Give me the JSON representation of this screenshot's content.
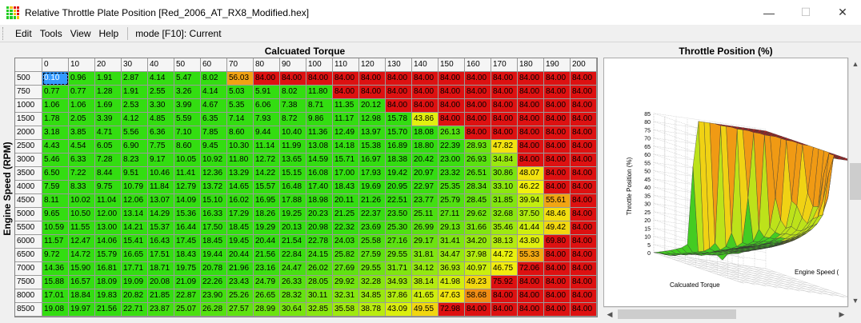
{
  "window": {
    "title": "Relative Throttle Plate Position [Red_2006_AT_RX8_Modified.hex]",
    "minimize": "—",
    "maximize": "☐",
    "close": "✕"
  },
  "menu": {
    "items": [
      "Edit",
      "Tools",
      "View",
      "Help"
    ],
    "mode": "mode [F10]: Current"
  },
  "table": {
    "title": "Calcuated Torque",
    "row_axis_title": "Engine Speed (RPM)",
    "columns": [
      "0",
      "10",
      "20",
      "30",
      "40",
      "50",
      "60",
      "70",
      "80",
      "90",
      "100",
      "110",
      "120",
      "130",
      "140",
      "150",
      "160",
      "170",
      "180",
      "190",
      "200"
    ],
    "rows": [
      {
        "rpm": "500",
        "values": [
          "0.10",
          "0.96",
          "1.91",
          "2.87",
          "4.14",
          "5.47",
          "8.02",
          "56.03",
          "84.00",
          "84.00",
          "84.00",
          "84.00",
          "84.00",
          "84.00",
          "84.00",
          "84.00",
          "84.00",
          "84.00",
          "84.00",
          "84.00",
          "84.00"
        ]
      },
      {
        "rpm": "750",
        "values": [
          "0.77",
          "0.77",
          "1.28",
          "1.91",
          "2.55",
          "3.26",
          "4.14",
          "5.03",
          "5.91",
          "8.02",
          "11.80",
          "84.00",
          "84.00",
          "84.00",
          "84.00",
          "84.00",
          "84.00",
          "84.00",
          "84.00",
          "84.00",
          "84.00"
        ]
      },
      {
        "rpm": "1000",
        "values": [
          "1.06",
          "1.06",
          "1.69",
          "2.53",
          "3.30",
          "3.99",
          "4.67",
          "5.35",
          "6.06",
          "7.38",
          "8.71",
          "11.35",
          "20.12",
          "84.00",
          "84.00",
          "84.00",
          "84.00",
          "84.00",
          "84.00",
          "84.00",
          "84.00"
        ]
      },
      {
        "rpm": "1500",
        "values": [
          "1.78",
          "2.05",
          "3.39",
          "4.12",
          "4.85",
          "5.59",
          "6.35",
          "7.14",
          "7.93",
          "8.72",
          "9.86",
          "11.17",
          "12.98",
          "15.78",
          "43.86",
          "84.00",
          "84.00",
          "84.00",
          "84.00",
          "84.00",
          "84.00"
        ]
      },
      {
        "rpm": "2000",
        "values": [
          "3.18",
          "3.85",
          "4.71",
          "5.56",
          "6.36",
          "7.10",
          "7.85",
          "8.60",
          "9.44",
          "10.40",
          "11.36",
          "12.49",
          "13.97",
          "15.70",
          "18.08",
          "26.13",
          "84.00",
          "84.00",
          "84.00",
          "84.00",
          "84.00"
        ]
      },
      {
        "rpm": "2500",
        "values": [
          "4.43",
          "4.54",
          "6.05",
          "6.90",
          "7.75",
          "8.60",
          "9.45",
          "10.30",
          "11.14",
          "11.99",
          "13.08",
          "14.18",
          "15.38",
          "16.89",
          "18.80",
          "22.39",
          "28.93",
          "47.82",
          "84.00",
          "84.00",
          "84.00"
        ]
      },
      {
        "rpm": "3000",
        "values": [
          "5.46",
          "6.33",
          "7.28",
          "8.23",
          "9.17",
          "10.05",
          "10.92",
          "11.80",
          "12.72",
          "13.65",
          "14.59",
          "15.71",
          "16.97",
          "18.38",
          "20.42",
          "23.00",
          "26.93",
          "34.84",
          "84.00",
          "84.00",
          "84.00"
        ]
      },
      {
        "rpm": "3500",
        "values": [
          "6.50",
          "7.22",
          "8.44",
          "9.51",
          "10.46",
          "11.41",
          "12.36",
          "13.29",
          "14.22",
          "15.15",
          "16.08",
          "17.00",
          "17.93",
          "19.42",
          "20.97",
          "23.32",
          "26.51",
          "30.86",
          "48.07",
          "84.00",
          "84.00"
        ]
      },
      {
        "rpm": "4000",
        "values": [
          "7.59",
          "8.33",
          "9.75",
          "10.79",
          "11.84",
          "12.79",
          "13.72",
          "14.65",
          "15.57",
          "16.48",
          "17.40",
          "18.43",
          "19.69",
          "20.95",
          "22.97",
          "25.35",
          "28.34",
          "33.10",
          "46.22",
          "84.00",
          "84.00"
        ]
      },
      {
        "rpm": "4500",
        "values": [
          "8.11",
          "10.02",
          "11.04",
          "12.06",
          "13.07",
          "14.09",
          "15.10",
          "16.02",
          "16.95",
          "17.88",
          "18.98",
          "20.11",
          "21.26",
          "22.51",
          "23.77",
          "25.79",
          "28.45",
          "31.85",
          "39.94",
          "55.61",
          "84.00"
        ]
      },
      {
        "rpm": "5000",
        "values": [
          "9.65",
          "10.50",
          "12.00",
          "13.14",
          "14.29",
          "15.36",
          "16.33",
          "17.29",
          "18.26",
          "19.25",
          "20.23",
          "21.25",
          "22.37",
          "23.50",
          "25.11",
          "27.11",
          "29.62",
          "32.68",
          "37.50",
          "48.46",
          "84.00"
        ]
      },
      {
        "rpm": "5500",
        "values": [
          "10.59",
          "11.55",
          "13.00",
          "14.21",
          "15.37",
          "16.44",
          "17.50",
          "18.45",
          "19.29",
          "20.13",
          "20.98",
          "22.32",
          "23.69",
          "25.30",
          "26.99",
          "29.13",
          "31.66",
          "35.46",
          "41.44",
          "49.42",
          "84.00"
        ]
      },
      {
        "rpm": "6000",
        "values": [
          "11.57",
          "12.47",
          "14.06",
          "15.41",
          "16.43",
          "17.45",
          "18.45",
          "19.45",
          "20.44",
          "21.54",
          "22.78",
          "24.03",
          "25.58",
          "27.16",
          "29.17",
          "31.41",
          "34.20",
          "38.13",
          "43.80",
          "69.80",
          "84.00"
        ]
      },
      {
        "rpm": "6500",
        "values": [
          "9.72",
          "14.72",
          "15.79",
          "16.65",
          "17.51",
          "18.43",
          "19.44",
          "20.44",
          "21.56",
          "22.84",
          "24.15",
          "25.82",
          "27.59",
          "29.55",
          "31.81",
          "34.47",
          "37.98",
          "44.72",
          "55.33",
          "84.00",
          "84.00"
        ]
      },
      {
        "rpm": "7000",
        "values": [
          "14.36",
          "15.90",
          "16.81",
          "17.71",
          "18.71",
          "19.75",
          "20.78",
          "21.96",
          "23.16",
          "24.47",
          "26.02",
          "27.69",
          "29.55",
          "31.71",
          "34.12",
          "36.93",
          "40.97",
          "46.75",
          "72.06",
          "84.00",
          "84.00"
        ]
      },
      {
        "rpm": "7500",
        "values": [
          "15.88",
          "16.57",
          "18.09",
          "19.09",
          "20.08",
          "21.09",
          "22.26",
          "23.43",
          "24.79",
          "26.33",
          "28.05",
          "29.92",
          "32.28",
          "34.93",
          "38.14",
          "41.98",
          "49.23",
          "75.92",
          "84.00",
          "84.00",
          "84.00"
        ]
      },
      {
        "rpm": "8000",
        "values": [
          "17.01",
          "18.84",
          "19.83",
          "20.82",
          "21.85",
          "22.87",
          "23.90",
          "25.26",
          "26.65",
          "28.32",
          "30.11",
          "32.31",
          "34.85",
          "37.86",
          "41.65",
          "47.63",
          "58.68",
          "84.00",
          "84.00",
          "84.00",
          "84.00"
        ]
      },
      {
        "rpm": "8500",
        "values": [
          "19.08",
          "19.97",
          "21.56",
          "22.71",
          "23.87",
          "25.07",
          "26.28",
          "27.57",
          "28.99",
          "30.64",
          "32.85",
          "35.58",
          "38.78",
          "43.09",
          "49.55",
          "72.98",
          "84.00",
          "84.00",
          "84.00",
          "84.00",
          "84.00"
        ]
      }
    ],
    "selected_cell": {
      "row": 0,
      "col": 0
    },
    "color_scale": {
      "low": "#33dd11",
      "mid": "#f2f20f",
      "high": "#dd1111"
    }
  },
  "chart": {
    "title": "Throttle Position (%)",
    "zlabel": "Throttle Position (%)",
    "xlabel": "Calcuated Torque",
    "ylabel": "Engine Speed (",
    "z_ticks": [
      "0",
      "5",
      "10",
      "15",
      "20",
      "25",
      "30",
      "35",
      "40",
      "45",
      "50",
      "55",
      "60",
      "65",
      "70",
      "75",
      "80",
      "85"
    ]
  },
  "scroll": {
    "up": "▲",
    "down": "▼",
    "left": "◀",
    "right": "▶"
  }
}
